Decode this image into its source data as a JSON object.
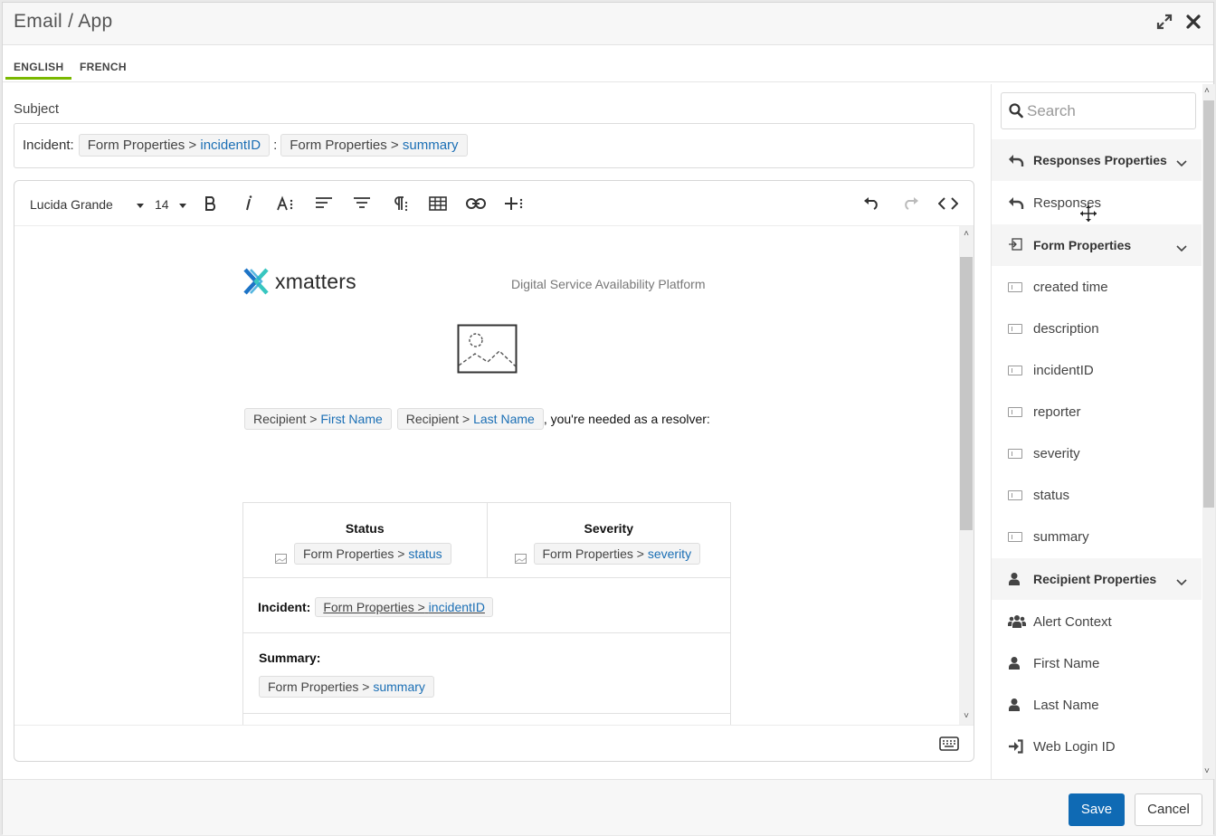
{
  "window": {
    "title": "Email / App"
  },
  "language_tabs": [
    {
      "label": "ENGLISH",
      "active": true
    },
    {
      "label": "FRENCH",
      "active": false
    }
  ],
  "subject": {
    "label": "Subject",
    "prefix": "Incident:",
    "separator": ":",
    "chips": [
      {
        "group": "Form Properties >",
        "field": "incidentID"
      },
      {
        "group": "Form Properties >",
        "field": "summary"
      }
    ]
  },
  "toolbar": {
    "font_family": "Lucida Grande",
    "font_size": "14",
    "icons": [
      "bold-icon",
      "italic-icon",
      "font-size-icon",
      "align-left-icon",
      "align-center-icon",
      "paragraph-icon",
      "table-icon",
      "link-icon",
      "insert-more-icon",
      "undo-icon",
      "redo-icon",
      "code-view-icon"
    ]
  },
  "email_body": {
    "logo_text": "xmatters",
    "tagline": "Digital Service Availability Platform",
    "greeting_chips": [
      {
        "group": "Recipient >",
        "field": "First Name"
      },
      {
        "group": "Recipient >",
        "field": "Last Name"
      }
    ],
    "greeting_suffix": ", you're needed as a resolver:",
    "table": {
      "status_header": "Status",
      "status_chip": {
        "group": "Form Properties >",
        "field": "status"
      },
      "severity_header": "Severity",
      "severity_chip": {
        "group": "Form Properties >",
        "field": "severity"
      },
      "incident_label": "Incident:",
      "incident_chip": {
        "group": "Form Properties >",
        "field": "incidentID"
      },
      "summary_label": "Summary:",
      "summary_chip": {
        "group": "Form Properties >",
        "field": "summary"
      }
    }
  },
  "sidebar": {
    "search_placeholder": "Search",
    "groups": [
      {
        "title": "Responses Properties",
        "icon": "reply-icon",
        "items": [
          {
            "label": "Responses",
            "icon": "reply-icon"
          }
        ]
      },
      {
        "title": "Form Properties",
        "icon": "form-import-icon",
        "items": [
          {
            "label": "created time",
            "icon": "field-icon"
          },
          {
            "label": "description",
            "icon": "field-icon"
          },
          {
            "label": "incidentID",
            "icon": "field-icon"
          },
          {
            "label": "reporter",
            "icon": "field-icon"
          },
          {
            "label": "severity",
            "icon": "field-icon"
          },
          {
            "label": "status",
            "icon": "field-icon"
          },
          {
            "label": "summary",
            "icon": "field-icon"
          }
        ]
      },
      {
        "title": "Recipient Properties",
        "icon": "user-icon",
        "items": [
          {
            "label": "Alert Context",
            "icon": "users-icon"
          },
          {
            "label": "First Name",
            "icon": "user-icon"
          },
          {
            "label": "Last Name",
            "icon": "user-icon"
          },
          {
            "label": "Web Login ID",
            "icon": "sign-in-icon"
          }
        ]
      }
    ]
  },
  "footer": {
    "save_label": "Save",
    "cancel_label": "Cancel"
  },
  "colors": {
    "accent": "#0f6ab4",
    "tab_underline": "#7ab800",
    "link": "#1b6fb5"
  }
}
